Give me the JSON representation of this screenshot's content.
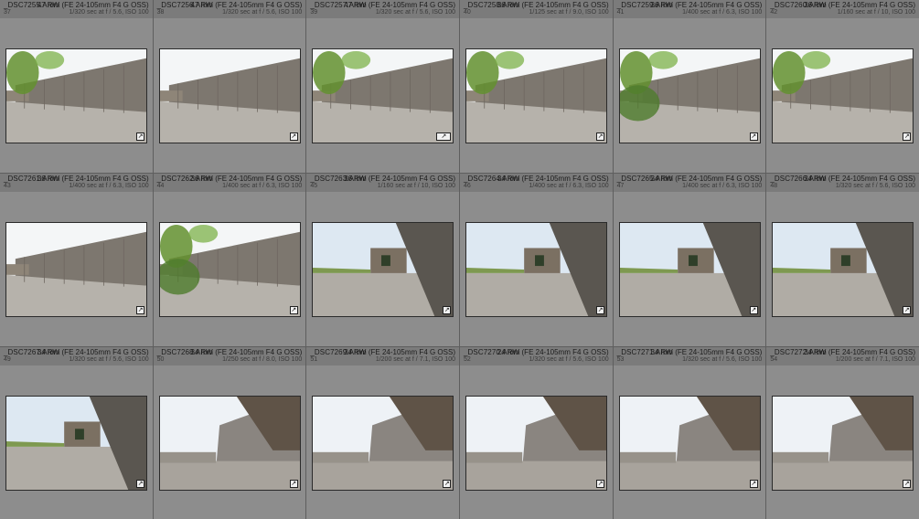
{
  "grid": {
    "items": [
      {
        "name": "_DSC7255.ARW",
        "index": "37",
        "lens": "47 mm (FE 24-105mm F4 G OSS)",
        "exposure": "1/320 sec at f / 5.6, ISO 100",
        "scene": "a",
        "leaves": true
      },
      {
        "name": "_DSC7256.ARW",
        "index": "38",
        "lens": "47 mm (FE 24-105mm F4 G OSS)",
        "exposure": "1/320 sec at f / 5.6, ISO 100",
        "scene": "a",
        "leaves": false
      },
      {
        "name": "_DSC7257.ARW",
        "index": "39",
        "lens": "47 mm (FE 24-105mm F4 G OSS)",
        "exposure": "1/320 sec at f / 5.6, ISO 100",
        "scene": "a",
        "leaves": true
      },
      {
        "name": "_DSC7258.ARW",
        "index": "40",
        "lens": "36 mm (FE 24-105mm F4 G OSS)",
        "exposure": "1/125 sec at f / 9.0, ISO 100",
        "scene": "a",
        "leaves": true
      },
      {
        "name": "_DSC7259.ARW",
        "index": "41",
        "lens": "36 mm (FE 24-105mm F4 G OSS)",
        "exposure": "1/400 sec at f / 6.3, ISO 100",
        "scene": "a",
        "leaves": true
      },
      {
        "name": "_DSC7260.ARW",
        "index": "42",
        "lens": "36 mm (FE 24-105mm F4 G OSS)",
        "exposure": "1/160 sec at f / 10, ISO 100",
        "scene": "a",
        "leaves": true
      },
      {
        "name": "_DSC7261.ARW",
        "index": "43",
        "lens": "36 mm (FE 24-105mm F4 G OSS)",
        "exposure": "1/400 sec at f / 6.3, ISO 100",
        "scene": "a",
        "leaves": false
      },
      {
        "name": "_DSC7262.ARW",
        "index": "44",
        "lens": "36 mm (FE 24-105mm F4 G OSS)",
        "exposure": "1/400 sec at f / 6.3, ISO 100",
        "scene": "a",
        "leaves": true
      },
      {
        "name": "_DSC7263.ARW",
        "index": "45",
        "lens": "36 mm (FE 24-105mm F4 G OSS)",
        "exposure": "1/160 sec at f / 10, ISO 100",
        "scene": "b",
        "leaves": false
      },
      {
        "name": "_DSC7264.ARW",
        "index": "46",
        "lens": "34 mm (FE 24-105mm F4 G OSS)",
        "exposure": "1/400 sec at f / 6.3, ISO 100",
        "scene": "b",
        "leaves": false
      },
      {
        "name": "_DSC7265.ARW",
        "index": "47",
        "lens": "34 mm (FE 24-105mm F4 G OSS)",
        "exposure": "1/400 sec at f / 6.3, ISO 100",
        "scene": "b",
        "leaves": false
      },
      {
        "name": "_DSC7266.ARW",
        "index": "48",
        "lens": "34 mm (FE 24-105mm F4 G OSS)",
        "exposure": "1/320 sec at f / 5.6, ISO 100",
        "scene": "b",
        "leaves": false
      },
      {
        "name": "_DSC7267.ARW",
        "index": "49",
        "lens": "34 mm (FE 24-105mm F4 G OSS)",
        "exposure": "1/320 sec at f / 5.6, ISO 100",
        "scene": "b",
        "leaves": false
      },
      {
        "name": "_DSC7268.ARW",
        "index": "50",
        "lens": "34 mm (FE 24-105mm F4 G OSS)",
        "exposure": "1/250 sec at f / 8.0, ISO 100",
        "scene": "c",
        "leaves": false
      },
      {
        "name": "_DSC7269.ARW",
        "index": "51",
        "lens": "34 mm (FE 24-105mm F4 G OSS)",
        "exposure": "1/200 sec at f / 7.1, ISO 100",
        "scene": "c",
        "leaves": false
      },
      {
        "name": "_DSC7270.ARW",
        "index": "52",
        "lens": "24 mm (FE 24-105mm F4 G OSS)",
        "exposure": "1/320 sec at f / 5.6, ISO 100",
        "scene": "c",
        "leaves": false
      },
      {
        "name": "_DSC7271.ARW",
        "index": "53",
        "lens": "34 mm (FE 24-105mm F4 G OSS)",
        "exposure": "1/320 sec at f / 5.6, ISO 100",
        "scene": "c",
        "leaves": false
      },
      {
        "name": "_DSC7272.ARW",
        "index": "54",
        "lens": "34 mm (FE 24-105mm F4 G OSS)",
        "exposure": "1/200 sec at f / 7.1, ISO 100",
        "scene": "c",
        "leaves": false
      }
    ]
  },
  "badge_icon": "external-edit-icon",
  "colors": {
    "sky": "#eef3f8",
    "wall": "#7c7770",
    "ground": "#b8b4ad",
    "shadow": "#4b4743",
    "leaf": "#6f9d3e",
    "frame": "#2a2a2a"
  }
}
